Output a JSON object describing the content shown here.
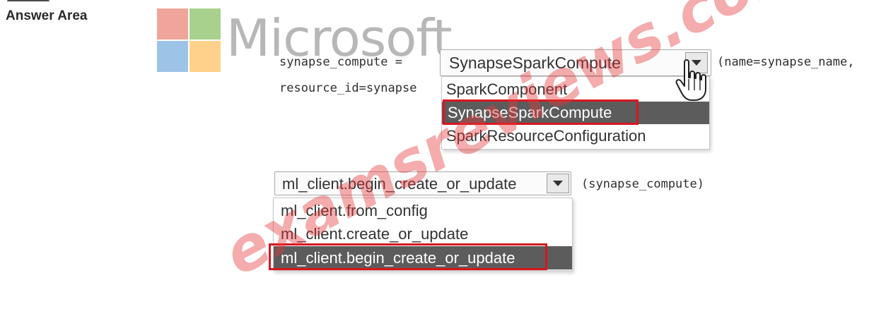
{
  "header": {
    "title": "Answer Area"
  },
  "logo": {
    "text": "Microsoft",
    "colors": [
      "#f25022",
      "#7fba00",
      "#00a4ef",
      "#ffb900"
    ]
  },
  "code": {
    "line1_prefix": "synapse_compute =",
    "line1_suffix": "(name=synapse_name,",
    "line2_prefix": "resource_id=synapse",
    "line3_suffix": "(synapse_compute)"
  },
  "dropdown1": {
    "selected_value": "SynapseSparkCompute",
    "options": [
      {
        "label": "SparkComponent",
        "selected": false,
        "answer": false
      },
      {
        "label": "SynapseSparkCompute",
        "selected": true,
        "answer": true
      },
      {
        "label": "SparkResourceConfiguration",
        "selected": false,
        "answer": false
      }
    ]
  },
  "dropdown2": {
    "selected_value": "ml_client.begin_create_or_update",
    "options": [
      {
        "label": "ml_client.from_config",
        "selected": false,
        "answer": false
      },
      {
        "label": "ml_client.create_or_update",
        "selected": false,
        "answer": false
      },
      {
        "label": "ml_client.begin_create_or_update",
        "selected": true,
        "answer": true
      }
    ]
  },
  "watermark": {
    "text": "examsreviews.com",
    "color": "#e53a3a"
  },
  "cursor": {
    "icon": "hand-pointer-icon"
  },
  "meta": {
    "width": 1253,
    "height": 438
  }
}
